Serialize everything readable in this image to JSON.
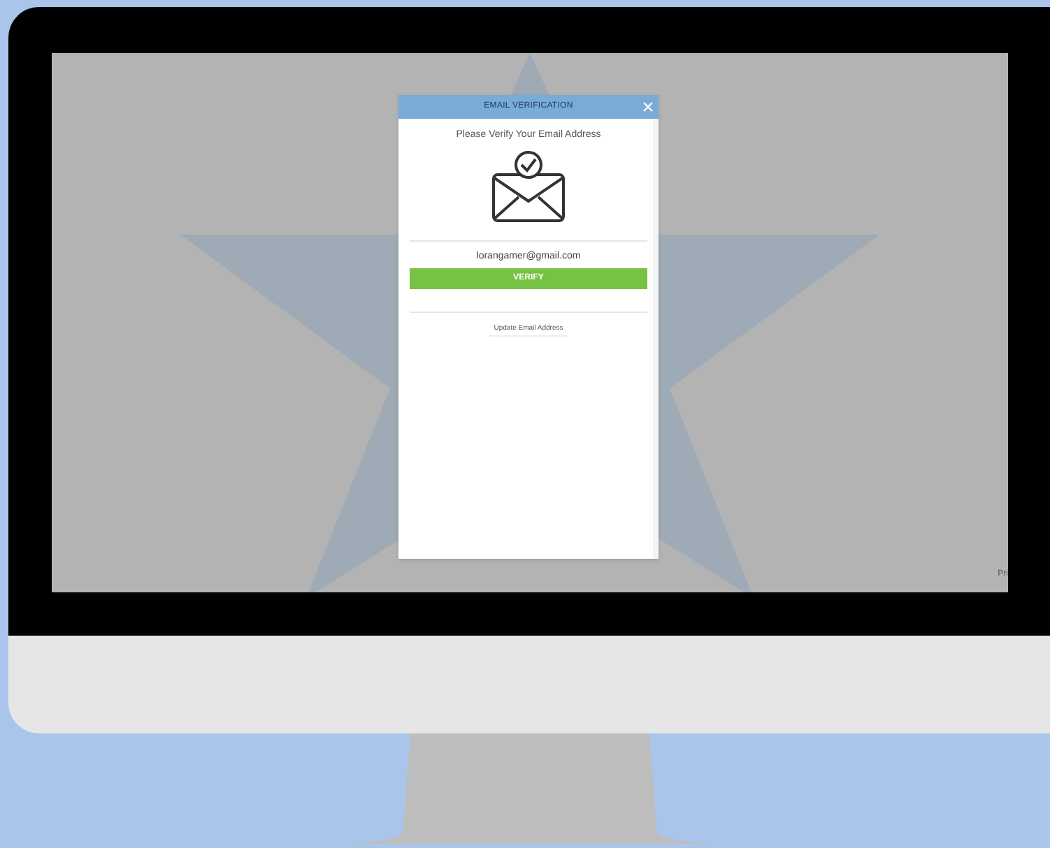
{
  "modal": {
    "title": "EMAIL VERIFICATION",
    "heading": "Please Verify Your Email Address",
    "email": "lorangamer@gmail.com",
    "verify_button": "VERIFY",
    "update_button": "Update Email Address"
  },
  "corner_text": "Pri"
}
